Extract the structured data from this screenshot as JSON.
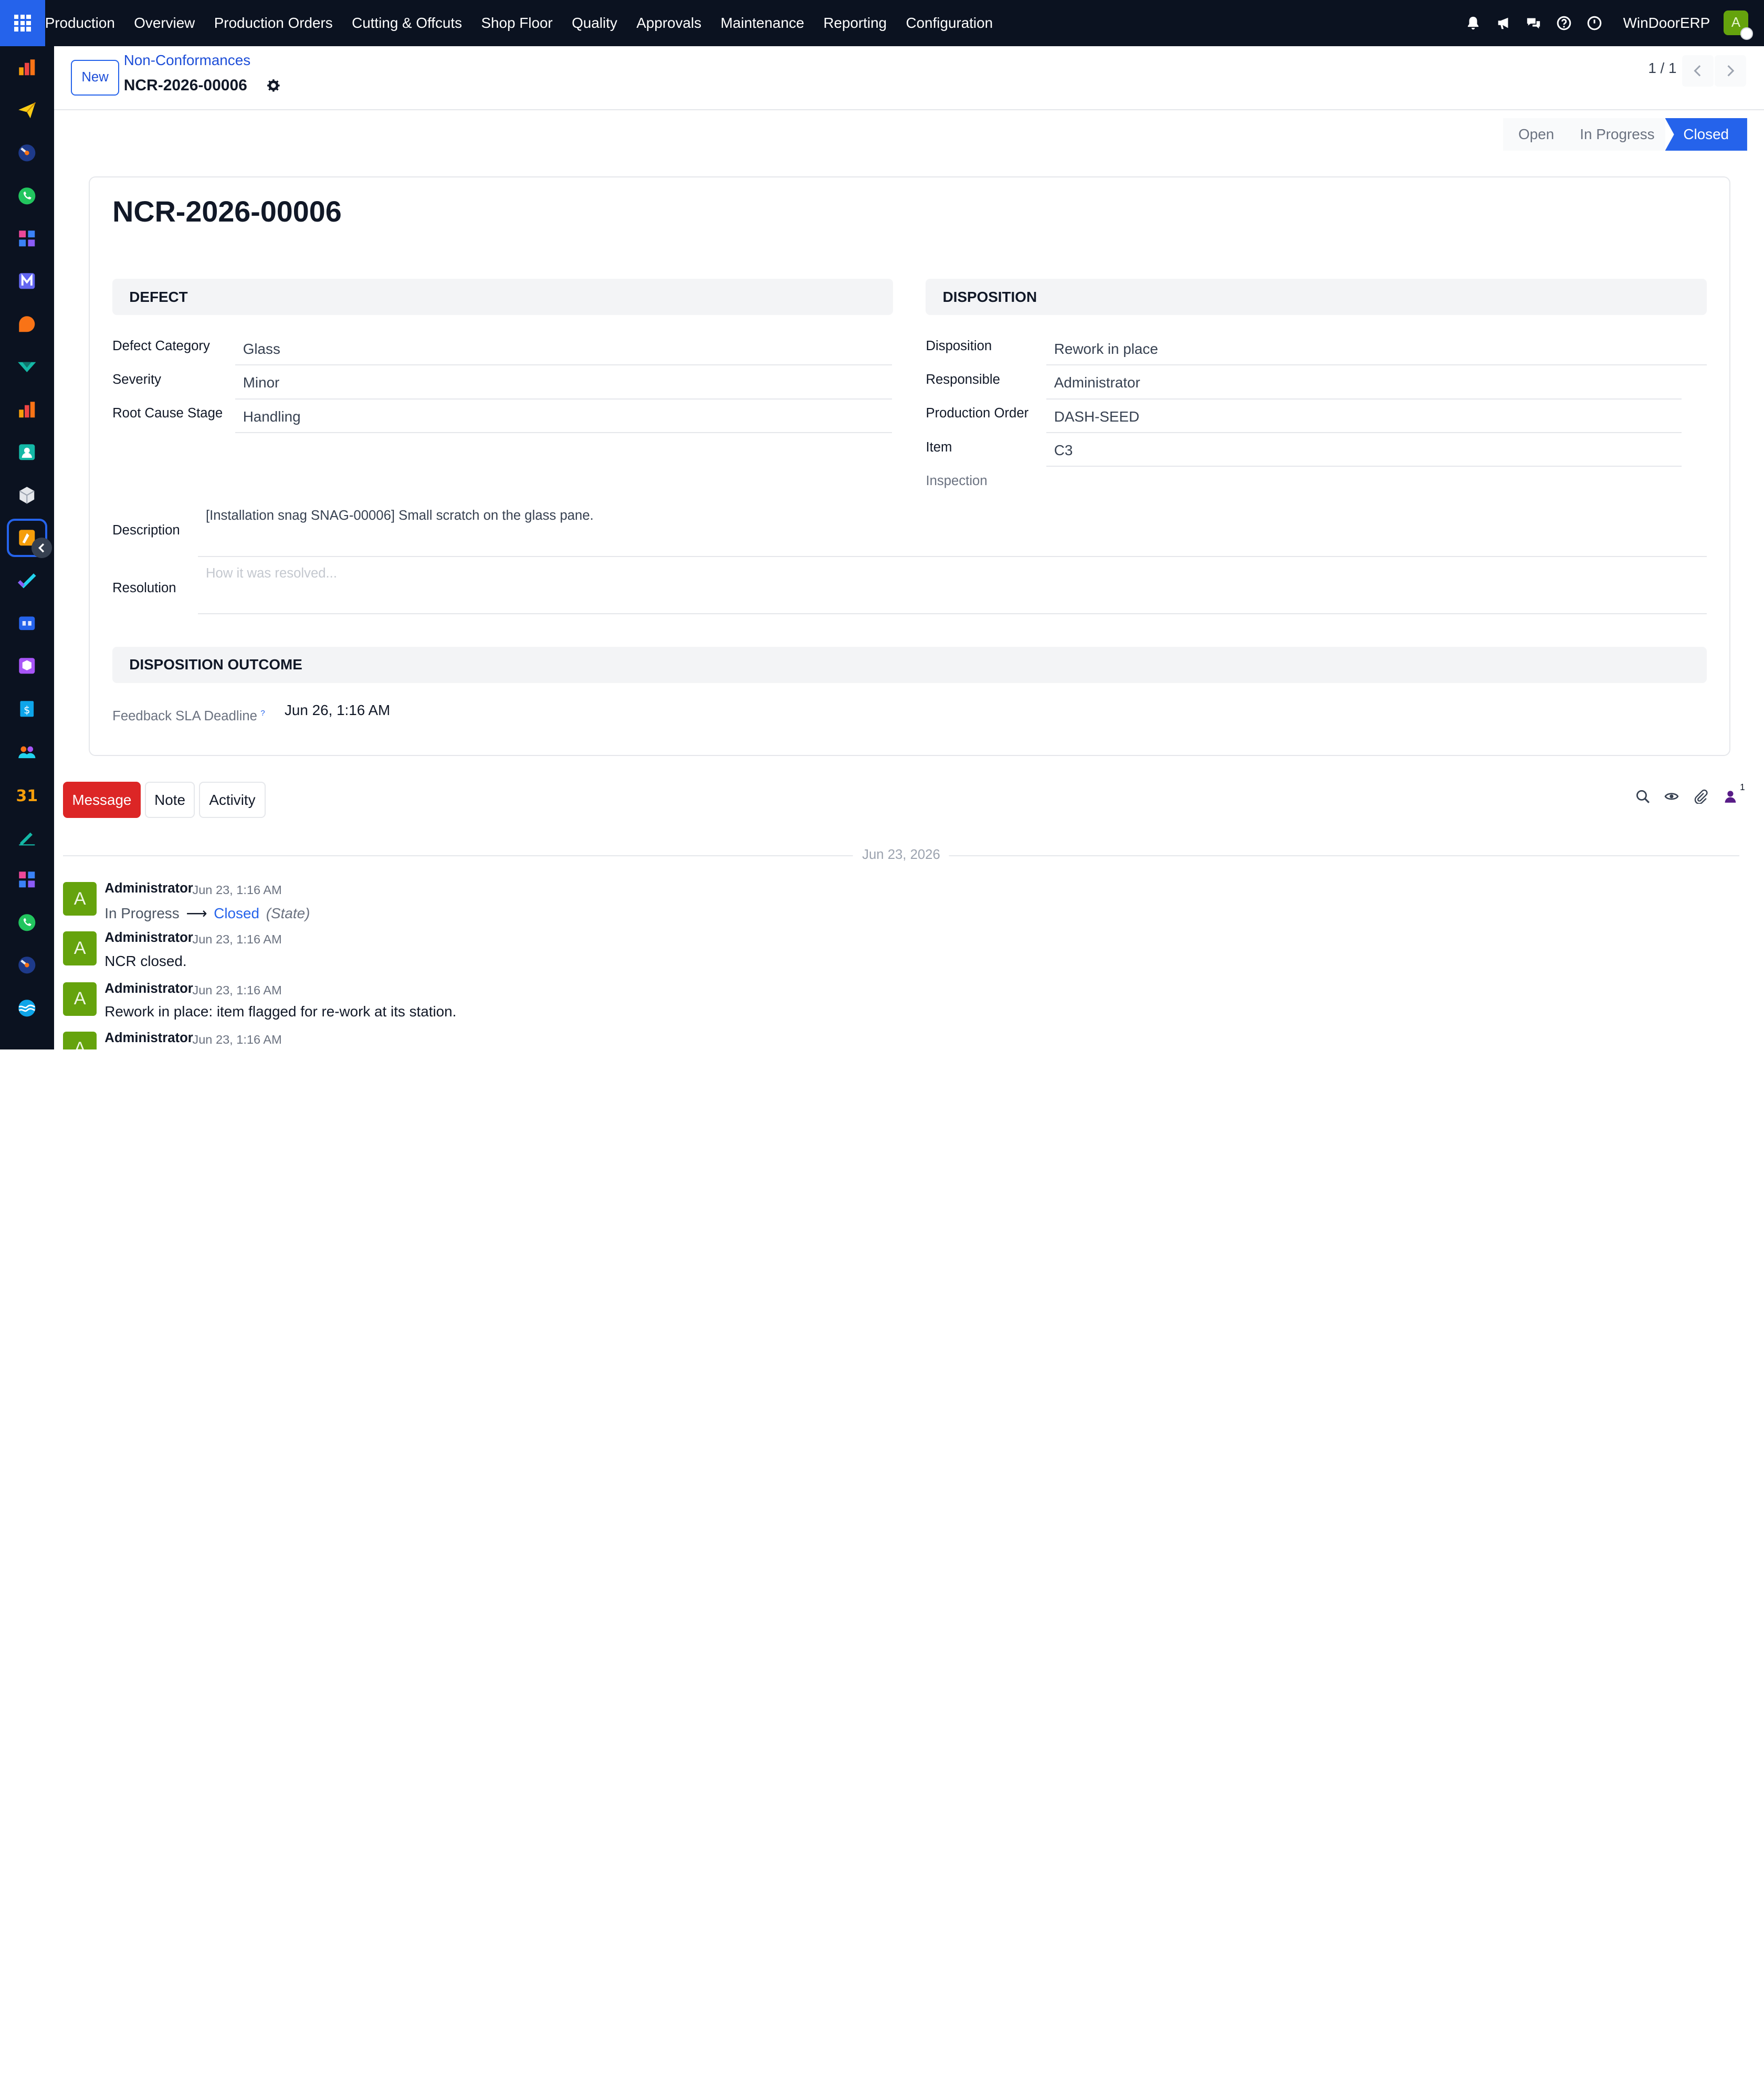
{
  "topbar": {
    "app_name": "Production",
    "menus": [
      "Overview",
      "Production Orders",
      "Cutting & Offcuts",
      "Shop Floor",
      "Quality",
      "Approvals",
      "Maintenance",
      "Reporting",
      "Configuration"
    ],
    "company": "WinDoorERP",
    "user_initial": "A"
  },
  "sidebar": {
    "apps": [
      "dashboard-app",
      "discuss-app",
      "time-app",
      "whatsapp-app",
      "knowledge-app",
      "mail-app",
      "live-chat-app",
      "marketing-app",
      "reporting-app",
      "contacts-app",
      "inventory-app",
      "production-app",
      "todo-app",
      "elearning-app",
      "packaging-app",
      "sales-app",
      "employees-app",
      "calendar-app",
      "sign-app",
      "dashboard-2-app",
      "whatsapp-2-app",
      "time-2-app",
      "website-app"
    ],
    "active_index": 11
  },
  "control_panel": {
    "new_label": "New",
    "breadcrumb_parent": "Non-Conformances",
    "breadcrumb_current": "NCR-2026-00006",
    "pager": "1 / 1"
  },
  "statusbar": {
    "states": [
      "Open",
      "In Progress",
      "Closed"
    ],
    "current": "Closed"
  },
  "record": {
    "title": "NCR-2026-00006",
    "defect": {
      "header": "DEFECT",
      "fields": [
        {
          "label": "Defect Category",
          "value": "Glass"
        },
        {
          "label": "Severity",
          "value": "Minor"
        },
        {
          "label": "Root Cause Stage",
          "value": "Handling"
        }
      ]
    },
    "disposition": {
      "header": "DISPOSITION",
      "fields": [
        {
          "label": "Disposition",
          "value": "Rework in place"
        },
        {
          "label": "Responsible",
          "value": "Administrator"
        },
        {
          "label": "Production Order",
          "value": "DASH-SEED"
        },
        {
          "label": "Item",
          "value": "C3"
        }
      ],
      "inspection_label": "Inspection"
    },
    "description_label": "Description",
    "description_value": "[Installation snag SNAG-00006] Small scratch on the glass pane.",
    "resolution_label": "Resolution",
    "resolution_placeholder": "How it was resolved...",
    "outcome_header": "DISPOSITION OUTCOME",
    "sla_label": "Feedback SLA Deadline",
    "sla_help": "?",
    "sla_value": "Jun 26, 1:16 AM"
  },
  "chatter": {
    "buttons": {
      "message": "Message",
      "note": "Note",
      "activity": "Activity"
    },
    "follower_count": "1",
    "date_separator": "Jun 23, 2026",
    "messages": [
      {
        "initial": "A",
        "author": "Administrator",
        "time": "Jun 23, 1:16 AM",
        "tracking_from": "In Progress",
        "tracking_to": "Closed",
        "tracking_field": "(State)"
      },
      {
        "initial": "A",
        "author": "Administrator",
        "time": "Jun 23, 1:16 AM",
        "body": "NCR closed."
      },
      {
        "initial": "A",
        "author": "Administrator",
        "time": "Jun 23, 1:16 AM",
        "body": "Rework in place: item flagged for re-work at its station."
      },
      {
        "initial": "A",
        "author": "Administrator",
        "time": "Jun 23, 1:16 AM",
        "body": ""
      }
    ]
  },
  "colors": {
    "accent": "#2563eb",
    "topbar": "#0b1220",
    "message_button": "#dc2626",
    "avatar": "#65a30d"
  }
}
